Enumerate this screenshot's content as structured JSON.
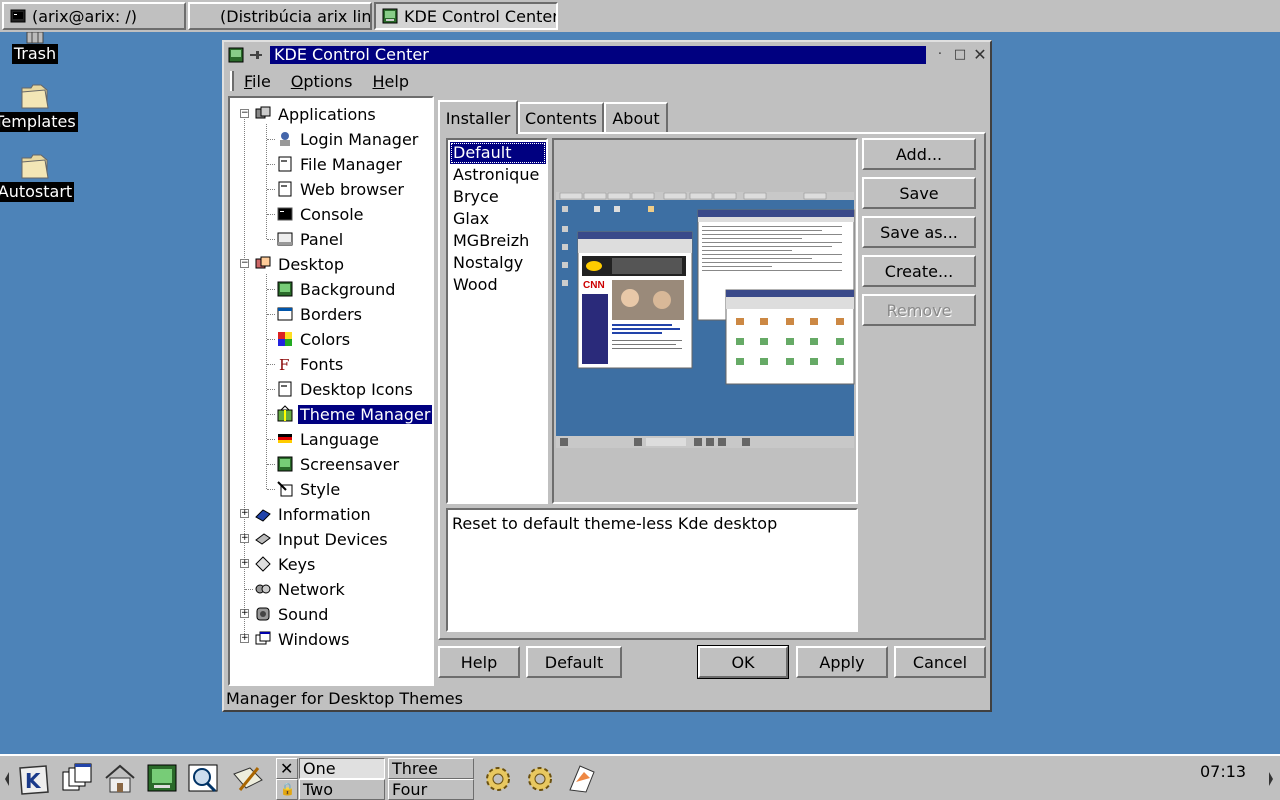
{
  "taskbar": {
    "items": [
      {
        "label": "(arix@arix: /)",
        "icon": "terminal-icon"
      },
      {
        "label": "(Distribúcia arix lin...",
        "icon": "none"
      },
      {
        "label": "KDE Control Center",
        "icon": "kcontrol-icon"
      }
    ]
  },
  "desktop": {
    "icons": [
      {
        "label": "Trash",
        "icon": "trash-icon"
      },
      {
        "label": "Templates",
        "icon": "folder-icon"
      },
      {
        "label": "Autostart",
        "icon": "folder-icon"
      }
    ]
  },
  "window": {
    "title": "KDE Control Center",
    "menu": [
      {
        "label": "File",
        "accel": "F",
        "rest": "ile"
      },
      {
        "label": "Options",
        "accel": "O",
        "rest": "ptions"
      },
      {
        "label": "Help",
        "accel": "H",
        "rest": "elp"
      }
    ],
    "tree": {
      "applications": "Applications",
      "apps_children": [
        "Login Manager",
        "File Manager",
        "Web browser",
        "Console",
        "Panel"
      ],
      "desktop": "Desktop",
      "desktop_children": [
        "Background",
        "Borders",
        "Colors",
        "Fonts",
        "Desktop Icons",
        "Theme Manager",
        "Language",
        "Screensaver",
        "Style"
      ],
      "other": [
        "Information",
        "Input Devices",
        "Keys",
        "Network",
        "Sound",
        "Windows"
      ],
      "selected": "Theme Manager"
    },
    "tabs": [
      "Installer",
      "Contents",
      "About"
    ],
    "active_tab": "Installer",
    "themes": [
      "Default",
      "Astronique",
      "Bryce",
      "Glax",
      "MGBreizh",
      "Nostalgy",
      "Wood"
    ],
    "selected_theme": "Default",
    "side_buttons": {
      "add": "Add...",
      "save": "Save",
      "save_as": "Save as...",
      "create": "Create...",
      "remove": "Remove"
    },
    "description": "Reset to default theme-less Kde desktop",
    "bottom_buttons": {
      "help": "Help",
      "default": "Default",
      "ok": "OK",
      "apply": "Apply",
      "cancel": "Cancel"
    },
    "status": "Manager for Desktop Themes"
  },
  "panel": {
    "desktops": [
      "One",
      "Two",
      "Three",
      "Four"
    ],
    "active_desktop": "One",
    "clock": "07:13"
  },
  "colors": {
    "desktop": "#4d83b8",
    "selection": "#000080",
    "face": "#c0c0c0"
  }
}
